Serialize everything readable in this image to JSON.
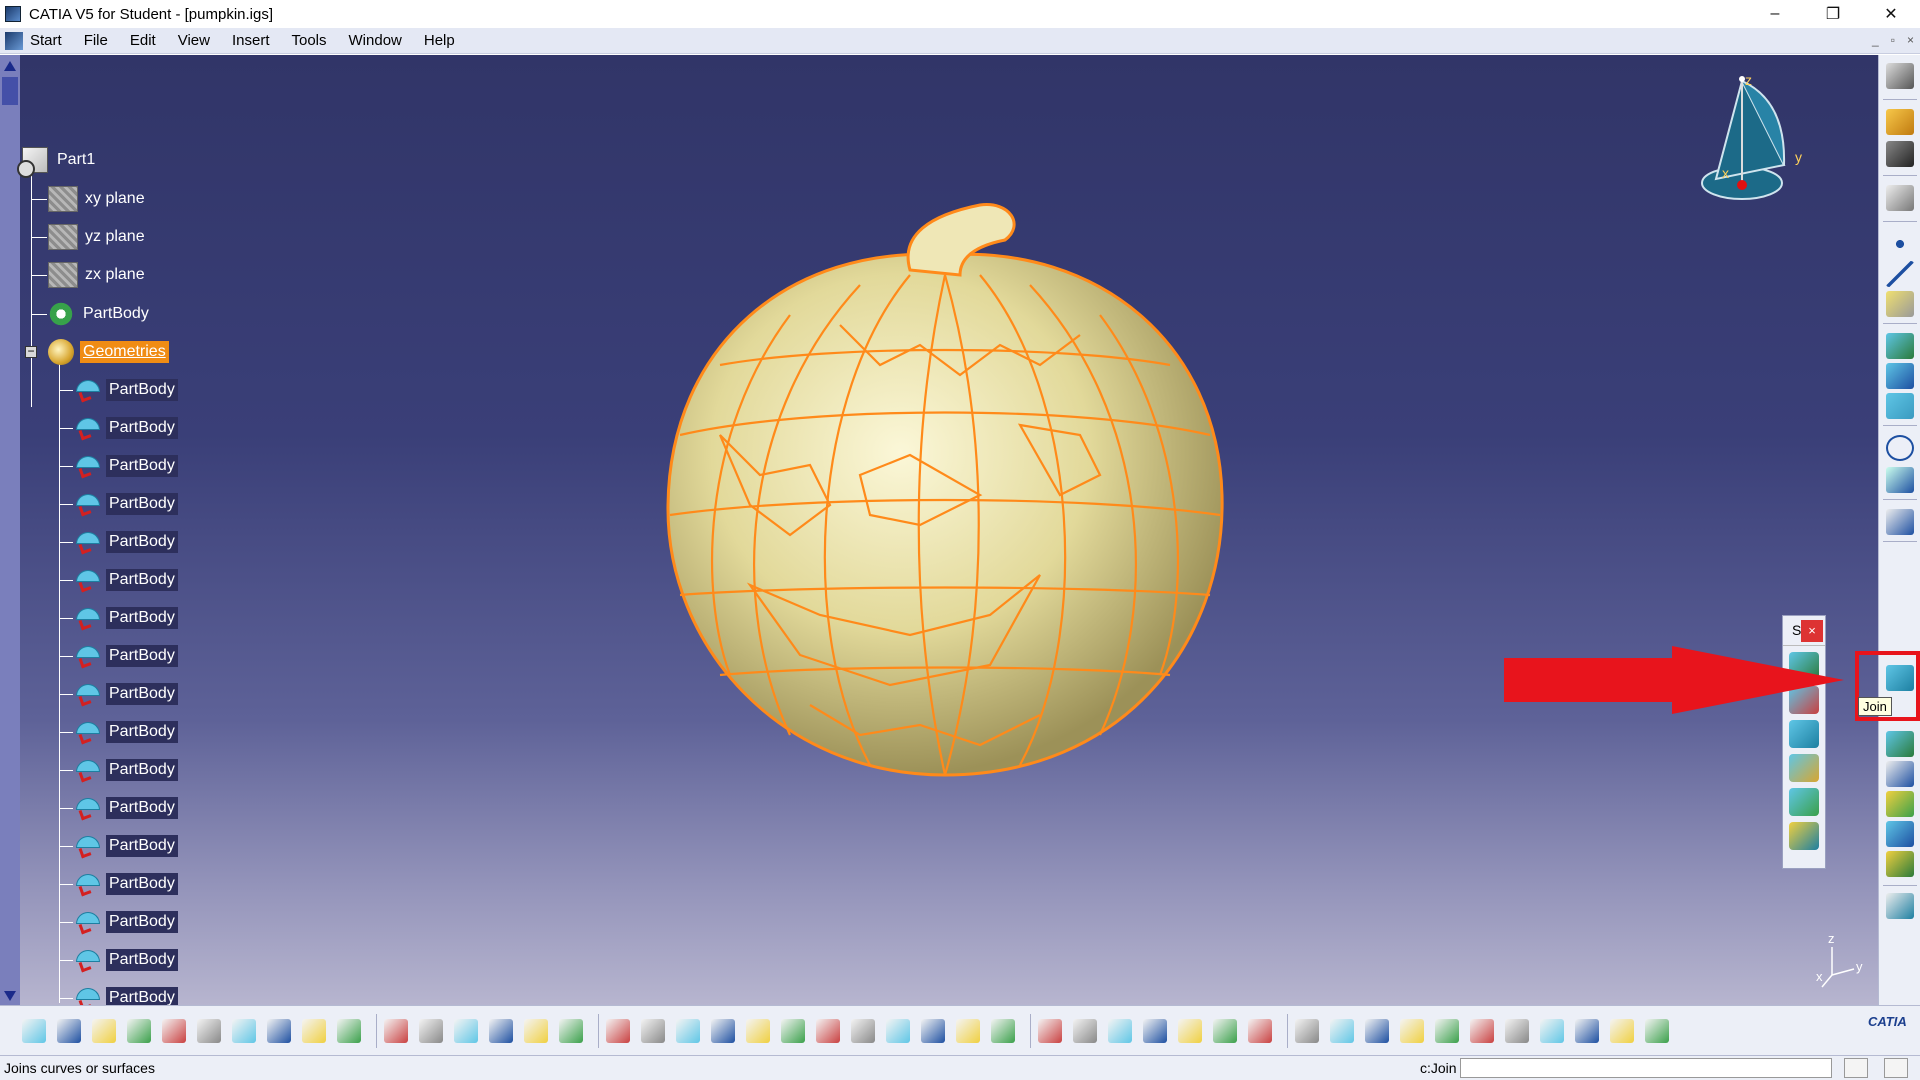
{
  "window": {
    "title": "CATIA V5 for Student - [pumpkin.igs]",
    "controls": {
      "minimize": "–",
      "restore": "❐",
      "close": "✕"
    }
  },
  "menu": {
    "items": [
      "Start",
      "File",
      "Edit",
      "View",
      "Insert",
      "Tools",
      "Window",
      "Help"
    ],
    "mdi_controls": [
      "_",
      "▫",
      "×"
    ]
  },
  "tree": {
    "root": "Part1",
    "planes": [
      "xy plane",
      "yz plane",
      "zx plane"
    ],
    "body": "PartBody",
    "geo_set": "Geometries",
    "surfaces": [
      "PartBody",
      "PartBody",
      "PartBody",
      "PartBody",
      "PartBody",
      "PartBody",
      "PartBody",
      "PartBody",
      "PartBody",
      "PartBody",
      "PartBody",
      "PartBody",
      "PartBody",
      "PartBody",
      "PartBody",
      "PartBody",
      "PartBody"
    ]
  },
  "compass": {
    "z": "z",
    "y": "y",
    "x": "x"
  },
  "triad": {
    "z": "z",
    "y": "y",
    "x": "x"
  },
  "floating_toolbar": {
    "label": "S",
    "close": "×"
  },
  "tooltip": "Join",
  "status": {
    "message": "Joins curves or surfaces",
    "command_label": "c:Join",
    "command_value": ""
  },
  "brand": "CATIA",
  "colors": {
    "selection": "#f08c14",
    "annotation": "#e8141c",
    "pumpkin_surface": "#e2d99a",
    "pumpkin_edges": "#ff8a1a"
  }
}
